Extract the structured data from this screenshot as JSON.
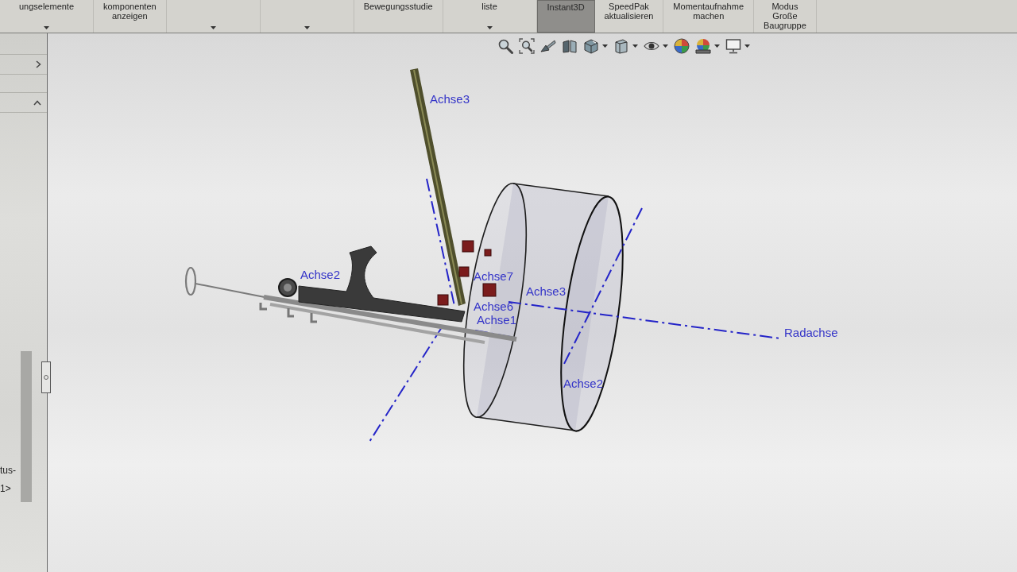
{
  "ribbon": {
    "items": [
      {
        "label": "ungselemente",
        "dropdown": true,
        "selected": false
      },
      {
        "label": "komponenten anzeigen",
        "dropdown": false,
        "selected": false
      },
      {
        "dropdown": true,
        "selected": false
      },
      {
        "dropdown": true,
        "selected": false
      },
      {
        "label": "Bewegungsstudie",
        "dropdown": false,
        "selected": false
      },
      {
        "label": "liste",
        "dropdown": true,
        "selected": false
      },
      {
        "label": "Instant3D",
        "dropdown": false,
        "selected": true
      },
      {
        "label": "SpeedPak aktualisieren",
        "dropdown": false,
        "selected": false
      },
      {
        "label": "Momentaufnahme machen",
        "dropdown": false,
        "selected": false
      },
      {
        "label": "Modus Große Baugruppe",
        "dropdown": false,
        "selected": false
      }
    ]
  },
  "feature_tree": {
    "sections": [
      {
        "expanded": false
      },
      {
        "expanded": true
      }
    ],
    "rows": [
      "tus-",
      "1>"
    ]
  },
  "view_toolbar": {
    "items": [
      {
        "kind": "tool"
      },
      {
        "kind": "tool"
      },
      {
        "kind": "tool"
      },
      {
        "kind": "tool"
      },
      {
        "kind": "tool"
      },
      {
        "kind": "caret"
      },
      {
        "kind": "tool"
      },
      {
        "kind": "caret"
      },
      {
        "kind": "tool"
      },
      {
        "kind": "caret"
      },
      {
        "kind": "tool"
      },
      {
        "kind": "tool"
      },
      {
        "kind": "caret"
      },
      {
        "kind": "tool"
      },
      {
        "kind": "caret"
      }
    ]
  },
  "graphics": {
    "labels": [
      "Achse3",
      "Achse2",
      "Achse7",
      "Achse3",
      "Achse6",
      "Achse1",
      "Radachse",
      "Achse2"
    ]
  }
}
